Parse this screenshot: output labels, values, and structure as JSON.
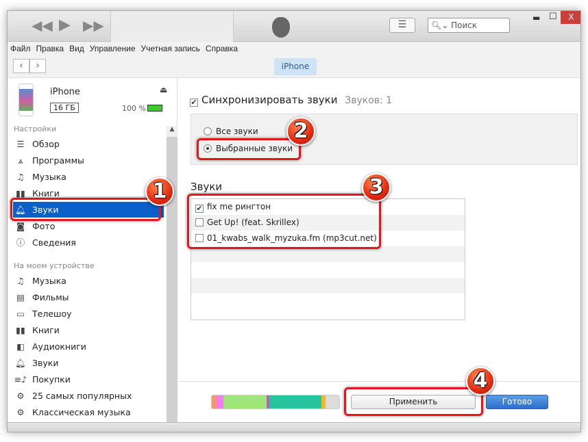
{
  "window": {
    "search_placeholder": "Поиск",
    "close": "X"
  },
  "menu": [
    "Файл",
    "Правка",
    "Вид",
    "Управление",
    "Учетная запись",
    "Справка"
  ],
  "nav": {
    "back": "‹",
    "forward": "›",
    "device_tab": "iPhone"
  },
  "device": {
    "name": "iPhone",
    "capacity": "16 ГБ",
    "battery": "100 %"
  },
  "sidebar": {
    "settings_header": "Настройки",
    "settings": [
      {
        "label": "Обзор",
        "icon": "list-icon"
      },
      {
        "label": "Программы",
        "icon": "apps-icon"
      },
      {
        "label": "Музыка",
        "icon": "music-note-icon"
      },
      {
        "label": "Книги",
        "icon": "book-icon"
      },
      {
        "label": "Звуки",
        "icon": "bell-icon",
        "selected": true
      },
      {
        "label": "Фото",
        "icon": "camera-icon"
      },
      {
        "label": "Сведения",
        "icon": "info-icon"
      }
    ],
    "device_header": "На моем устройстве",
    "device_items": [
      {
        "label": "Музыка",
        "icon": "music-note-icon"
      },
      {
        "label": "Фильмы",
        "icon": "film-icon"
      },
      {
        "label": "Телешоу",
        "icon": "tv-icon"
      },
      {
        "label": "Книги",
        "icon": "book-icon"
      },
      {
        "label": "Аудиокниги",
        "icon": "audiobook-icon"
      },
      {
        "label": "Звуки",
        "icon": "bell-icon"
      },
      {
        "label": "Покупки",
        "icon": "purchases-icon"
      },
      {
        "label": "25 самых популярных",
        "icon": "gear-icon"
      },
      {
        "label": "Классическая музыка",
        "icon": "gear-icon"
      }
    ]
  },
  "main": {
    "sync_label": "Синхронизировать звуки",
    "sync_checked": true,
    "count": "Звуков: 1",
    "all_sounds": "Все звуки",
    "selected_sounds": "Выбранные звуки",
    "list_title": "Звуки",
    "sounds": [
      {
        "label": "fix me рингтон",
        "checked": true
      },
      {
        "label": "Get Up! (feat. Skrillex)",
        "checked": false
      },
      {
        "label": "01_kwabs_walk_myzuka.fm (mp3cut.net)",
        "checked": false
      }
    ],
    "apply": "Применить",
    "done": "Готово"
  },
  "storage_bar": [
    {
      "color": "#f5956a",
      "pct": 4
    },
    {
      "color": "#f57cf0",
      "pct": 5
    },
    {
      "color": "#a0e57a",
      "pct": 34
    },
    {
      "color": "#c060b0",
      "pct": 2
    },
    {
      "color": "#28c4a0",
      "pct": 41
    },
    {
      "color": "#f5b820",
      "pct": 3
    },
    {
      "color": "#dcdcdc",
      "pct": 11
    }
  ],
  "callouts": [
    "1",
    "2",
    "3",
    "4"
  ]
}
